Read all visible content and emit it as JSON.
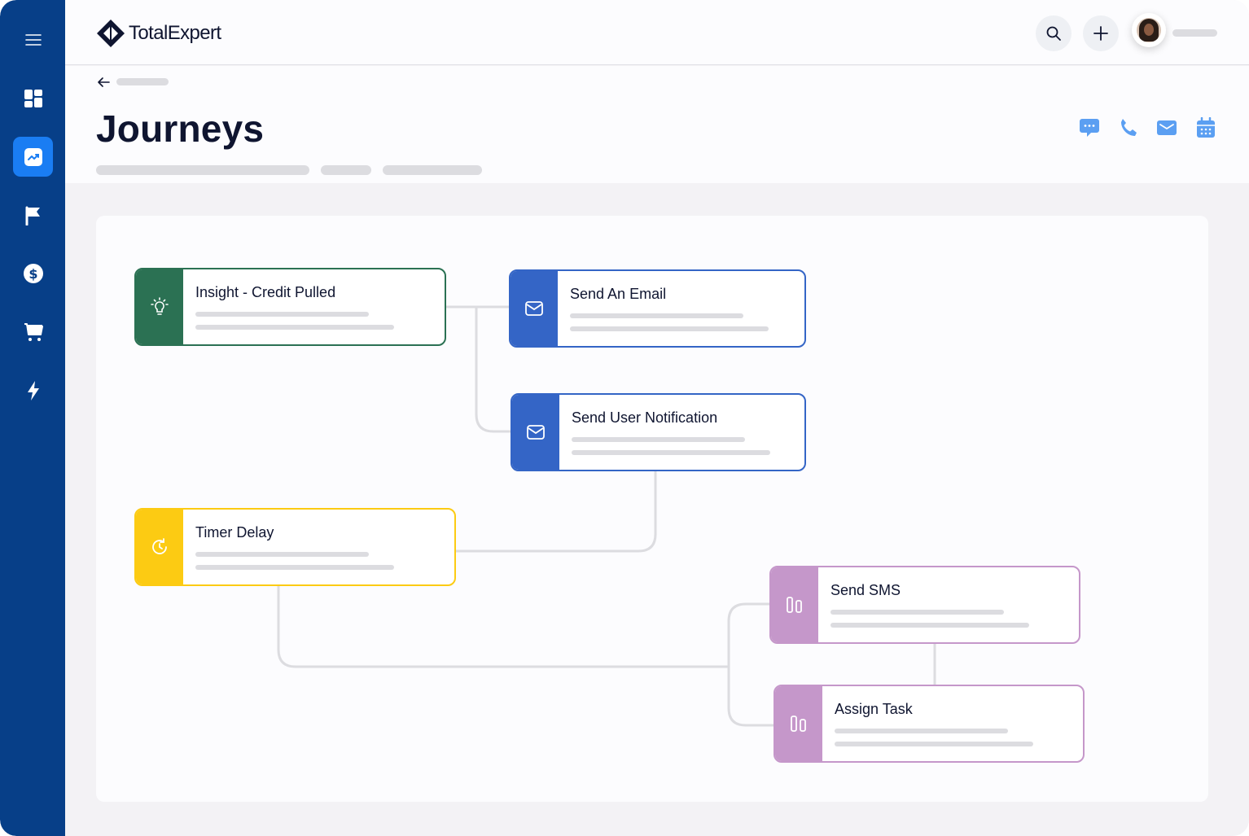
{
  "app": {
    "logo_text": "TotalExpert"
  },
  "sidebar": {
    "items": [
      {
        "name": "menu",
        "icon": "hamburger-icon",
        "active": false
      },
      {
        "name": "dashboard",
        "icon": "grid-icon",
        "active": false
      },
      {
        "name": "journeys",
        "icon": "trend-chart-icon",
        "active": true
      },
      {
        "name": "campaigns",
        "icon": "flag-icon",
        "active": false
      },
      {
        "name": "loans",
        "icon": "dollar-icon",
        "active": false
      },
      {
        "name": "marketplace",
        "icon": "cart-icon",
        "active": false
      },
      {
        "name": "automations",
        "icon": "lightning-icon",
        "active": false
      }
    ]
  },
  "page": {
    "title": "Journeys",
    "actions": [
      "chat-icon",
      "phone-icon",
      "email-icon",
      "calendar-icon"
    ]
  },
  "journey": {
    "nodes": [
      {
        "id": "insight",
        "title": "Insight - Credit Pulled",
        "type": "trigger",
        "color": "#2b7153",
        "icon": "lightbulb-icon"
      },
      {
        "id": "email",
        "title": "Send An Email",
        "type": "action",
        "color": "#3465c6",
        "icon": "envelope-icon"
      },
      {
        "id": "notification",
        "title": "Send User Notification",
        "type": "action",
        "color": "#3465c6",
        "icon": "envelope-icon"
      },
      {
        "id": "timer",
        "title": "Timer Delay",
        "type": "delay",
        "color": "#fccb13",
        "icon": "clock-icon"
      },
      {
        "id": "sms",
        "title": "Send SMS",
        "type": "task",
        "color": "#c597ca",
        "icon": "columns-icon"
      },
      {
        "id": "task",
        "title": "Assign Task",
        "type": "task",
        "color": "#c597ca",
        "icon": "columns-icon"
      }
    ]
  },
  "colors": {
    "sidebar": "#073f88",
    "active_accent": "#1a7df3",
    "action_icons": "#5b9ff2"
  }
}
